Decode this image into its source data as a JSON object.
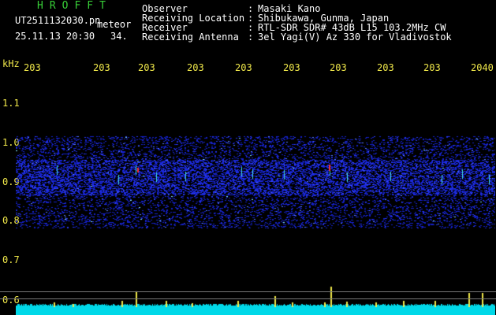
{
  "header": {
    "brand": "HROFFT",
    "filename": "UT2511132030.pn",
    "tag": "meteor",
    "datetime": "25.11.13 20:30",
    "count": "34.",
    "fields": [
      {
        "label": "Observer",
        "sep": ":",
        "value": "Masaki Kano"
      },
      {
        "label": "Receiving Location",
        "sep": ":",
        "value": "Shibukawa, Gunma, Japan"
      },
      {
        "label": "Receiver",
        "sep": ":",
        "value": "RTL-SDR SDR# 43dB L15 103.2MHz CW"
      },
      {
        "label": "Receiving Antenna",
        "sep": ":",
        "value": "3el Yagi(V) Az 330 for Vladivostok"
      }
    ]
  },
  "axis": {
    "y_unit": "kHz",
    "y_ticks": [
      "1.1",
      "1.0",
      "0.9",
      "0.8",
      "0.7",
      "0.6"
    ],
    "x_ticks": [
      "203",
      "203",
      "203",
      "203",
      "203",
      "203",
      "203",
      "203",
      "203",
      "2040"
    ]
  },
  "colors": {
    "background": "#000000",
    "noise": "#1a2bd8",
    "label": "#f0e84a",
    "brand": "#38d038",
    "text": "#ffffff",
    "signal_base": "#00d8e8"
  }
}
